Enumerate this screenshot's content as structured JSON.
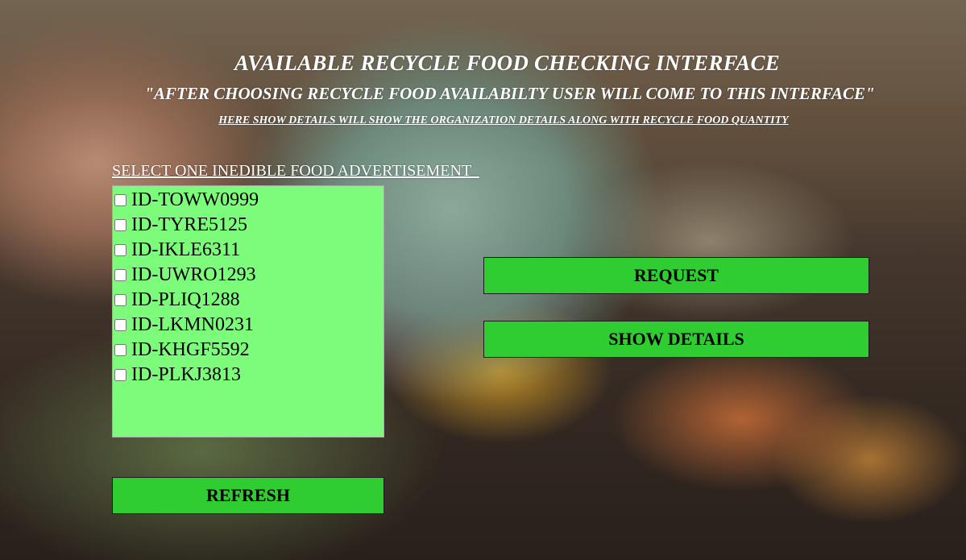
{
  "header": {
    "title": "AVAILABLE RECYCLE FOOD CHECKING INTERFACE",
    "subtitle": "\"AFTER CHOOSING RECYCLE FOOD AVAILABILTY USER WILL COME TO THIS INTERFACE\"",
    "note": "HERE SHOW DETAILS WILL SHOW THE ORGANIZATION DETAILS ALONG WITH RECYCLE FOOD QUANTITY"
  },
  "list": {
    "label": "SELECT ONE INEDIBLE FOOD ADVERTISEMENT  ",
    "items": [
      {
        "id": "ID-TOWW0999",
        "checked": false
      },
      {
        "id": "ID-TYRE5125",
        "checked": false
      },
      {
        "id": "ID-IKLE6311",
        "checked": false
      },
      {
        "id": "ID-UWRO1293",
        "checked": false
      },
      {
        "id": "ID-PLIQ1288",
        "checked": false
      },
      {
        "id": "ID-LKMN0231",
        "checked": false
      },
      {
        "id": "ID-KHGF5592",
        "checked": false
      },
      {
        "id": "ID-PLKJ3813",
        "checked": false
      }
    ]
  },
  "buttons": {
    "request": "REQUEST",
    "show_details": "SHOW DETAILS",
    "refresh": "REFRESH"
  },
  "colors": {
    "list_background": "#7dfc7b",
    "button_background": "#2fcd31",
    "heading_text": "#ffffff"
  }
}
